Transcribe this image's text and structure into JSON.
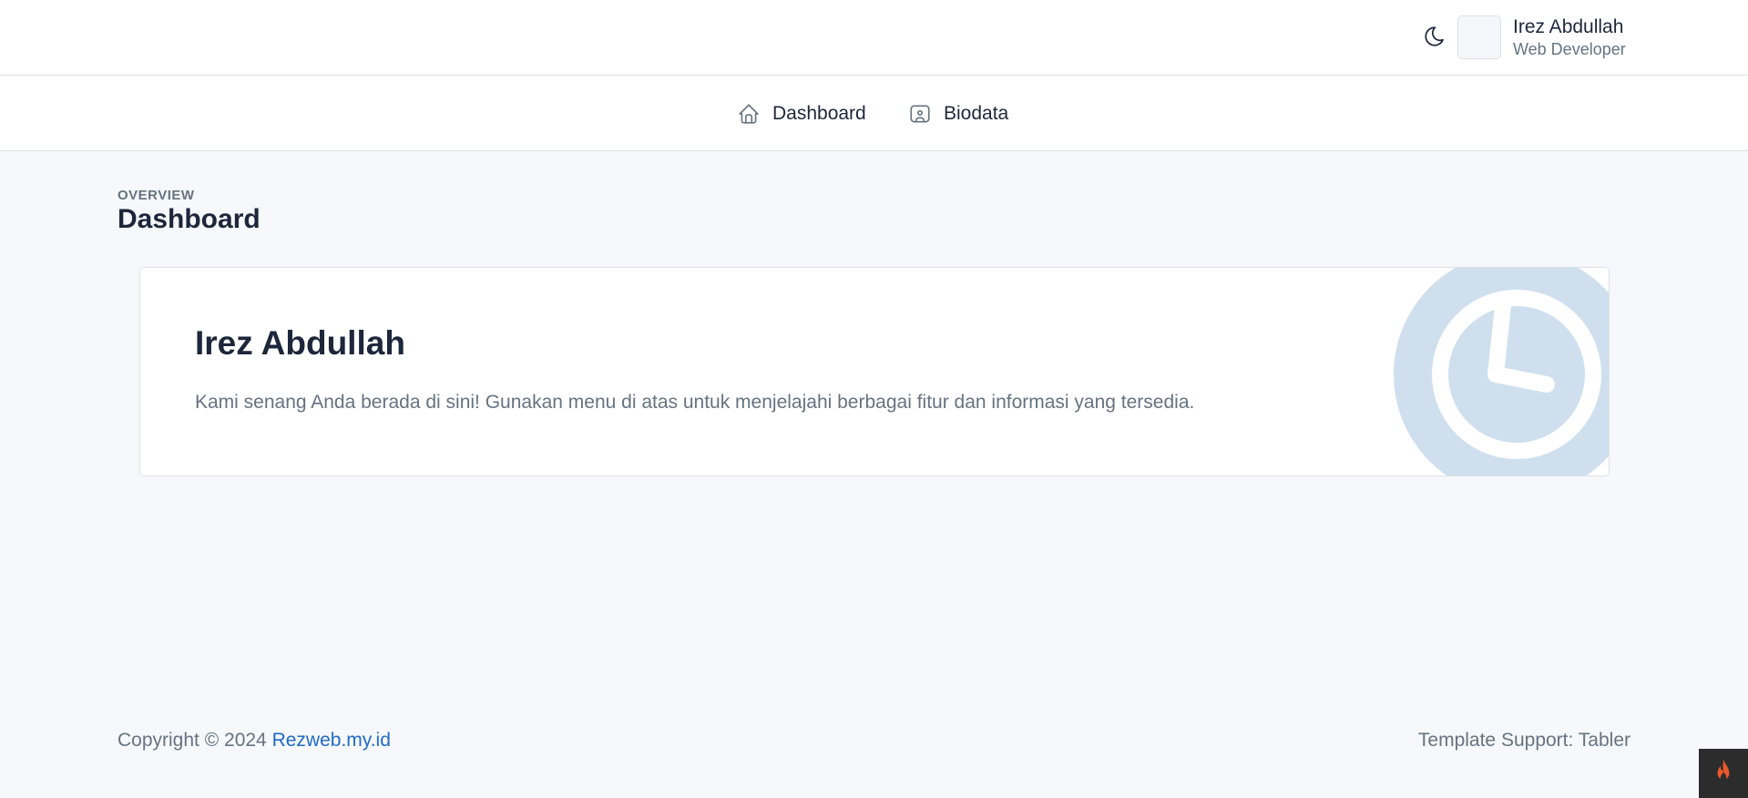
{
  "header": {
    "user_name": "Irez Abdullah",
    "user_role": "Web Developer",
    "theme_icon": "moon-icon"
  },
  "nav": {
    "items": [
      {
        "label": "Dashboard",
        "icon": "home-icon"
      },
      {
        "label": "Biodata",
        "icon": "user-badge-icon"
      }
    ]
  },
  "page": {
    "pretitle": "OVERVIEW",
    "title": "Dashboard"
  },
  "welcome_card": {
    "title": "Irez Abdullah",
    "text": "Kami senang Anda berada di sini! Gunakan menu di atas untuk menjelajahi berbagai fitur dan informasi yang tersedia.",
    "bg_icon": "clock-icon"
  },
  "footer": {
    "copyright_prefix": "Copyright © 2024 ",
    "link_text": "Rezweb.my.id",
    "template_support": "Template Support: Tabler"
  },
  "colors": {
    "accent": "#206bc4",
    "text_primary": "#1d273b",
    "text_muted": "#667382",
    "page_bg": "#f6f8fb",
    "clock_fill": "#cfdfee",
    "corner_widget_bg": "#2c2c2c",
    "corner_flame": "#e8592c"
  }
}
